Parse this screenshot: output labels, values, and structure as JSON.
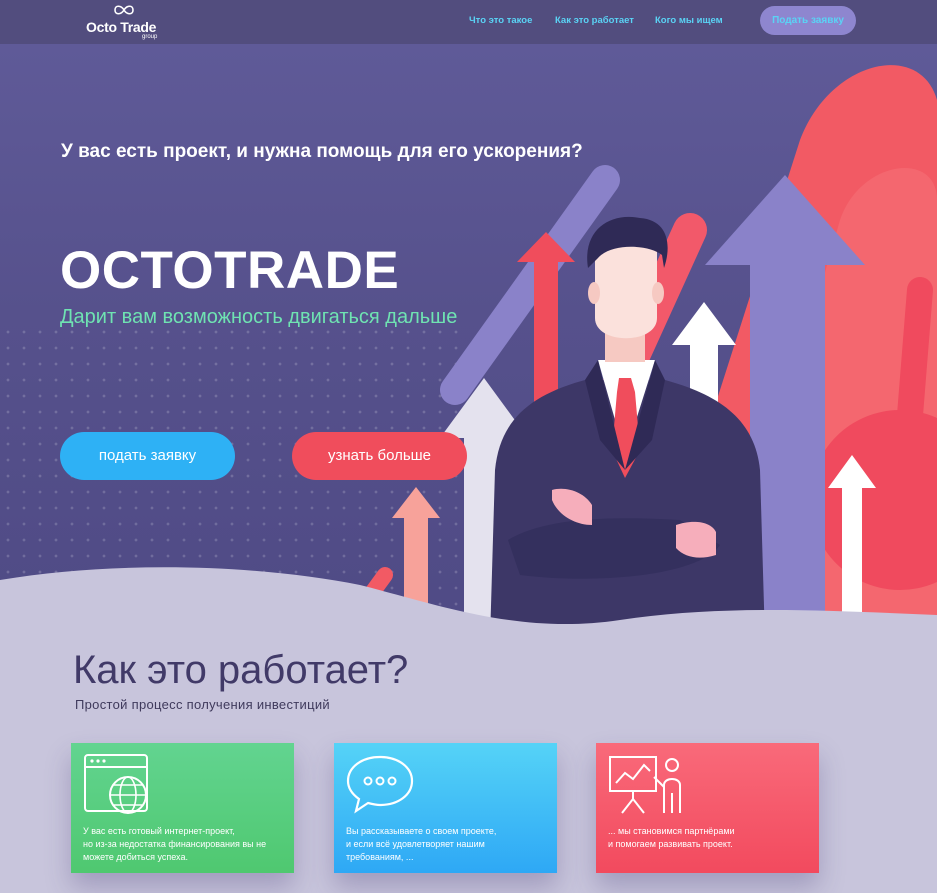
{
  "logo": {
    "name": "Octo Trade",
    "sub": "group"
  },
  "nav": {
    "links": [
      "Что это такое",
      "Как это работает",
      "Кого мы ищем"
    ],
    "cta": "Подать заявку"
  },
  "hero": {
    "question": "У вас есть проект, и нужна помощь для его ускорения?",
    "title": "OCTOTRADE",
    "subtitle": "Дарит вам возможность двигаться дальше",
    "btn_apply": "подать заявку",
    "btn_more": "узнать больше"
  },
  "how": {
    "title": "Как это работает?",
    "subtitle": "Простой процесс получения инвестиций"
  },
  "cards": [
    {
      "lines": [
        "У вас есть готовый интернет-проект,",
        "но из-за недостатка финансирования вы не",
        "можете добиться успеха."
      ],
      "icon": "browser-globe-icon"
    },
    {
      "lines": [
        "Вы рассказываете о своем проекте,",
        "и если всё удовлетворяет нашим",
        "требованиям, ..."
      ],
      "icon": "speech-bubble-icon"
    },
    {
      "lines": [
        "... мы становимся партнёрами",
        "и помогаем развивать проект."
      ],
      "icon": "presentation-icon"
    }
  ],
  "colors": {
    "nav_bg": "#524d7e",
    "hero_bg": "#5f5a98",
    "accent_cyan": "#5ad3f5",
    "accent_green": "#6fe3b2",
    "btn_blue": "#2eb1f5",
    "btn_red": "#f04d5c",
    "card_green": "#4fc870",
    "card_blue": "#2ea8f5",
    "card_red": "#f24a5e"
  }
}
